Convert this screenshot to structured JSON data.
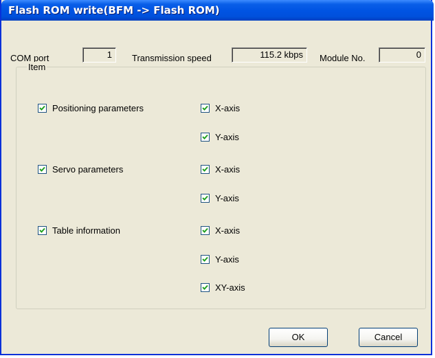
{
  "window": {
    "title": "Flash ROM write(BFM -> Flash ROM)"
  },
  "com_port": {
    "label": "COM port",
    "value": "1"
  },
  "transmission_speed": {
    "label": "Transmission speed",
    "value": "115.2 kbps"
  },
  "module_no": {
    "label": "Module No.",
    "value": "0"
  },
  "item_group": {
    "label": "Item",
    "positioning": {
      "label": "Positioning parameters",
      "checked": true,
      "x_axis": "X-axis",
      "y_axis": "Y-axis"
    },
    "servo": {
      "label": "Servo parameters",
      "checked": true,
      "x_axis": "X-axis",
      "y_axis": "Y-axis"
    },
    "table": {
      "label": "Table information",
      "checked": true,
      "x_axis": "X-axis",
      "y_axis": "Y-axis",
      "xy_axis": "XY-axis"
    }
  },
  "buttons": {
    "ok": "OK",
    "cancel": "Cancel"
  },
  "colors": {
    "title_bar": "#0054e3",
    "dialog_bg": "#ece9d8",
    "checkmark": "#21a121"
  }
}
